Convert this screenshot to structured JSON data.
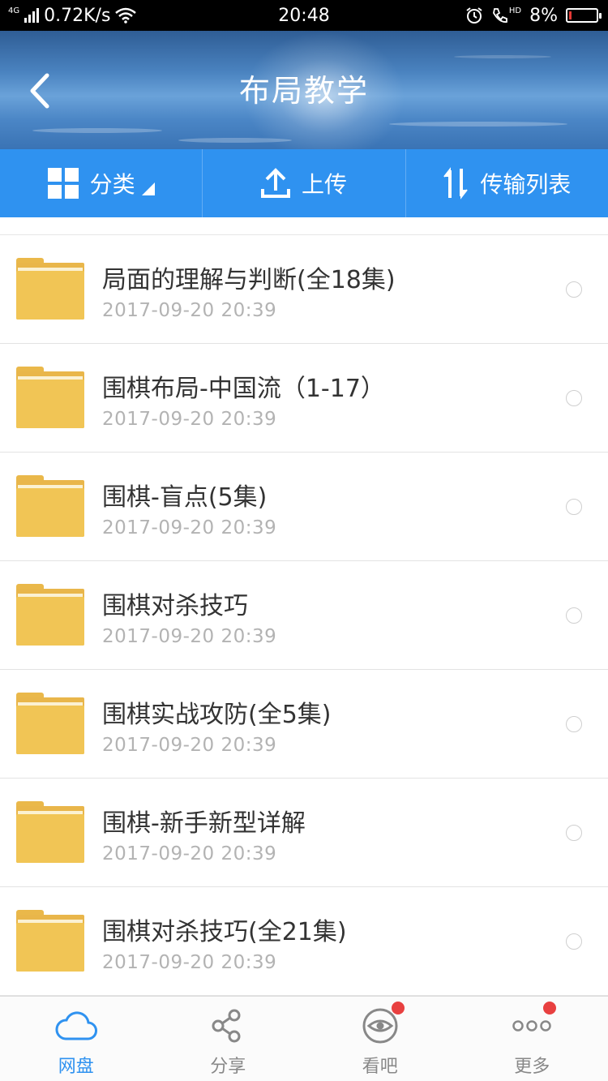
{
  "status_bar": {
    "network": "4G",
    "speed": "0.72K/s",
    "time": "20:48",
    "hd_label": "HD",
    "battery": "8%",
    "battery_level": 0.08
  },
  "header": {
    "title": "布局教学",
    "back_icon": "chevron-left-icon"
  },
  "toolbar": {
    "category_label": "分类",
    "upload_label": "上传",
    "transfer_label": "传输列表"
  },
  "files": [
    {
      "name": "局面的理解与判断(全18集)",
      "date": "2017-09-20  20:39"
    },
    {
      "name": "围棋布局-中国流（1-17）",
      "date": "2017-09-20  20:39"
    },
    {
      "name": "围棋-盲点(5集)",
      "date": "2017-09-20  20:39"
    },
    {
      "name": "围棋对杀技巧",
      "date": "2017-09-20  20:39"
    },
    {
      "name": "围棋实战攻防(全5集)",
      "date": "2017-09-20  20:39"
    },
    {
      "name": "围棋-新手新型详解",
      "date": "2017-09-20  20:39"
    },
    {
      "name": "围棋对杀技巧(全21集)",
      "date": "2017-09-20  20:39"
    }
  ],
  "bottom_nav": [
    {
      "label": "网盘",
      "icon": "cloud-icon",
      "active": true,
      "badge": false
    },
    {
      "label": "分享",
      "icon": "share-icon",
      "active": false,
      "badge": false
    },
    {
      "label": "看吧",
      "icon": "eye-icon",
      "active": false,
      "badge": true
    },
    {
      "label": "更多",
      "icon": "more-icon",
      "active": false,
      "badge": true
    }
  ],
  "colors": {
    "accent": "#2f92f0",
    "folder": "#f1c555",
    "badge": "#e84040"
  }
}
